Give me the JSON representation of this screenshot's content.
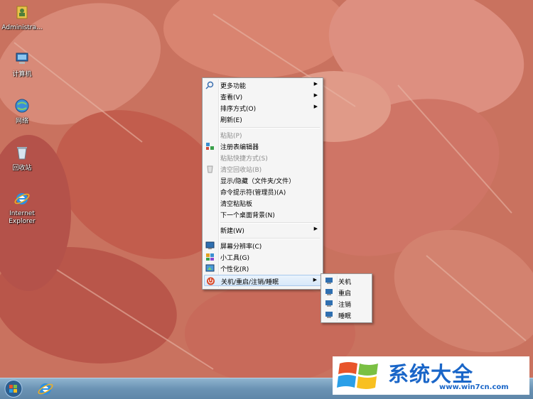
{
  "desktop": {
    "icons": [
      {
        "label": "Administra...",
        "icon": "user-folder-icon"
      },
      {
        "label": "计算机",
        "icon": "computer-icon"
      },
      {
        "label": "网络",
        "icon": "network-icon"
      },
      {
        "label": "回收站",
        "icon": "recycle-bin-icon"
      },
      {
        "label_line1": "Internet",
        "label_line2": "Explorer",
        "icon": "internet-explorer-icon"
      }
    ]
  },
  "context_menu": {
    "items": [
      {
        "label": "更多功能",
        "submenu": true,
        "icon": "search-icon"
      },
      {
        "label": "查看(V)",
        "submenu": true
      },
      {
        "label": "排序方式(O)",
        "submenu": true
      },
      {
        "label": "刷新(E)"
      },
      {
        "label": "粘贴(P)",
        "disabled": true
      },
      {
        "label": "注册表编辑器",
        "icon": "registry-icon"
      },
      {
        "label": "粘贴快捷方式(S)",
        "disabled": true
      },
      {
        "label": "清空回收站(B)",
        "disabled": true,
        "icon": "recycle-bin-icon"
      },
      {
        "label": "显示/隐藏（文件夹/文件）"
      },
      {
        "label": "命令提示符(管理员)(A)"
      },
      {
        "label": "清空粘贴板"
      },
      {
        "label": "下一个桌面背景(N)"
      },
      {
        "label": "新建(W)",
        "submenu": true
      },
      {
        "label": "屏幕分辨率(C)",
        "icon": "display-icon"
      },
      {
        "label": "小工具(G)",
        "icon": "gadgets-icon"
      },
      {
        "label": "个性化(R)",
        "icon": "personalize-icon"
      },
      {
        "label": "关机/重启/注销/睡眠",
        "submenu": true,
        "highlighted": true,
        "icon": "power-icon"
      }
    ]
  },
  "power_submenu": {
    "items": [
      {
        "label": "关机"
      },
      {
        "label": "重启"
      },
      {
        "label": "注销"
      },
      {
        "label": "睡眠"
      }
    ]
  },
  "watermark": {
    "title": "系统大全",
    "url": "www.win7cn.com"
  },
  "colors": {
    "menu_bg": "#f5f5f5",
    "highlight": "#d7e8f9",
    "taskbar": "#6b93b4",
    "logo_blue": "#1a66c8"
  }
}
